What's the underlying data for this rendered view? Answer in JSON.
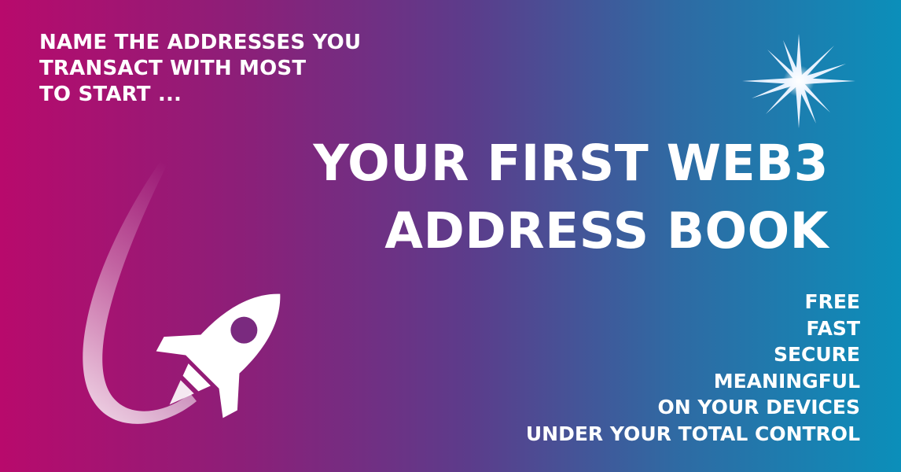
{
  "banner": {
    "intro_lines": [
      "NAME THE ADDRESSES YOU",
      "TRANSACT WITH MOST",
      "TO START ..."
    ],
    "headline_lines": [
      "YOUR FIRST WEB3",
      "ADDRESS BOOK"
    ],
    "features": [
      "FREE",
      "FAST",
      "SECURE",
      "MEANINGFUL",
      "ON YOUR DEVICES",
      "UNDER YOUR TOTAL CONTROL"
    ],
    "icons": {
      "sparkle": "sparkle-star-icon",
      "rocket": "rocket-icon"
    },
    "colors": {
      "gradient_left": "#b80a6c",
      "gradient_right": "#0b8fba",
      "text": "#ffffff"
    }
  }
}
